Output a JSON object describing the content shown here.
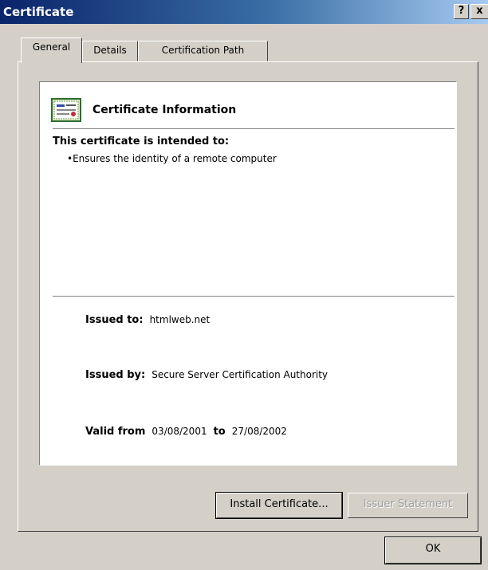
{
  "window": {
    "title": "Certificate"
  },
  "titlebar": {
    "help_label": "?",
    "close_label": "x"
  },
  "tabs": [
    {
      "label": "General",
      "active": true
    },
    {
      "label": "Details",
      "active": false
    },
    {
      "label": "Certification Path",
      "active": false
    }
  ],
  "certificate": {
    "header": "Certificate Information",
    "icon": "certificate-icon",
    "intended_label": "This certificate is intended to:",
    "purposes": [
      "•Ensures the identity of a remote computer"
    ],
    "issued_to_label": "Issued to:",
    "issued_to": "htmlweb.net",
    "issued_by_label": "Issued by:",
    "issued_by": "Secure Server Certification Authority",
    "valid_from_label": "Valid from",
    "valid_from": "03/08/2001",
    "valid_to_label": "to",
    "valid_to": "27/08/2002"
  },
  "buttons": {
    "install": "Install Certificate...",
    "issuer_statement": "Issuer Statement",
    "ok": "OK"
  },
  "colors": {
    "title_bar_start": "#0a246a",
    "title_bar_end": "#a6caf0",
    "dialog_face": "#d4d0c8"
  }
}
